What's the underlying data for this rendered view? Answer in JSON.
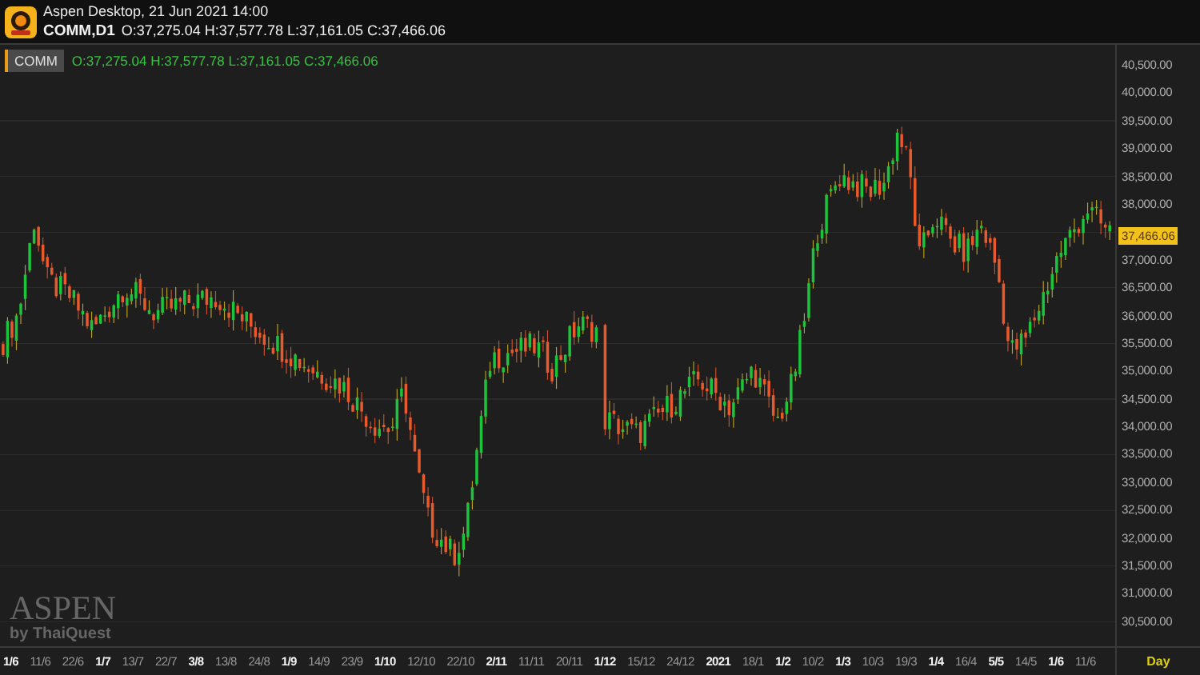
{
  "header": {
    "app_title": "Aspen Desktop, 21 Jun 2021 14:00",
    "symbol": "COMM,D1",
    "ohlc": "O:37,275.04 H:37,577.78 L:37,161.05 C:37,466.06"
  },
  "legend": {
    "symbol": "COMM",
    "ohlc": "O:37,275.04 H:37,577.78 L:37,161.05 C:37,466.06"
  },
  "price_axis": {
    "labels": [
      {
        "text": "40,500.00",
        "kind": "tick"
      },
      {
        "text": "40,000.00",
        "kind": "tick"
      },
      {
        "text": "39,500.00",
        "kind": "tick"
      },
      {
        "text": "39,000.00",
        "kind": "tick"
      },
      {
        "text": "38,500.00",
        "kind": "tick"
      },
      {
        "text": "38,000.00",
        "kind": "tick"
      },
      {
        "text": "37,466.06",
        "kind": "last_price"
      },
      {
        "text": "37,000.00",
        "kind": "tick"
      },
      {
        "text": "36,500.00",
        "kind": "tick"
      },
      {
        "text": "36,000.00",
        "kind": "tick"
      },
      {
        "text": "35,500.00",
        "kind": "tick"
      },
      {
        "text": "35,000.00",
        "kind": "tick"
      },
      {
        "text": "34,500.00",
        "kind": "tick"
      },
      {
        "text": "34,000.00",
        "kind": "tick"
      },
      {
        "text": "33,500.00",
        "kind": "tick"
      },
      {
        "text": "33,000.00",
        "kind": "tick"
      },
      {
        "text": "32,500.00",
        "kind": "tick"
      },
      {
        "text": "32,000.00",
        "kind": "tick"
      },
      {
        "text": "31,500.00",
        "kind": "tick"
      },
      {
        "text": "31,000.00",
        "kind": "tick"
      },
      {
        "text": "30,500.00",
        "kind": "tick"
      }
    ]
  },
  "date_axis": {
    "labels": [
      {
        "text": "1/6",
        "major": true
      },
      {
        "text": "11/6",
        "major": false
      },
      {
        "text": "22/6",
        "major": false
      },
      {
        "text": "1/7",
        "major": true
      },
      {
        "text": "13/7",
        "major": false
      },
      {
        "text": "22/7",
        "major": false
      },
      {
        "text": "3/8",
        "major": true
      },
      {
        "text": "13/8",
        "major": false
      },
      {
        "text": "24/8",
        "major": false
      },
      {
        "text": "1/9",
        "major": true
      },
      {
        "text": "14/9",
        "major": false
      },
      {
        "text": "23/9",
        "major": false
      },
      {
        "text": "1/10",
        "major": true
      },
      {
        "text": "12/10",
        "major": false
      },
      {
        "text": "22/10",
        "major": false
      },
      {
        "text": "2/11",
        "major": true
      },
      {
        "text": "11/11",
        "major": false
      },
      {
        "text": "20/11",
        "major": false
      },
      {
        "text": "1/12",
        "major": true
      },
      {
        "text": "15/12",
        "major": false
      },
      {
        "text": "24/12",
        "major": false
      },
      {
        "text": "2021",
        "major": true
      },
      {
        "text": "18/1",
        "major": false
      },
      {
        "text": "1/2",
        "major": true
      },
      {
        "text": "10/2",
        "major": false
      },
      {
        "text": "1/3",
        "major": true
      },
      {
        "text": "10/3",
        "major": false
      },
      {
        "text": "19/3",
        "major": false
      },
      {
        "text": "1/4",
        "major": true
      },
      {
        "text": "16/4",
        "major": false
      },
      {
        "text": "5/5",
        "major": true
      },
      {
        "text": "14/5",
        "major": false
      },
      {
        "text": "1/6",
        "major": true
      },
      {
        "text": "11/6",
        "major": false
      }
    ],
    "timeframe": "Day"
  },
  "watermark": {
    "name": "ASPEN",
    "byline": "by ThaiQuest"
  }
}
